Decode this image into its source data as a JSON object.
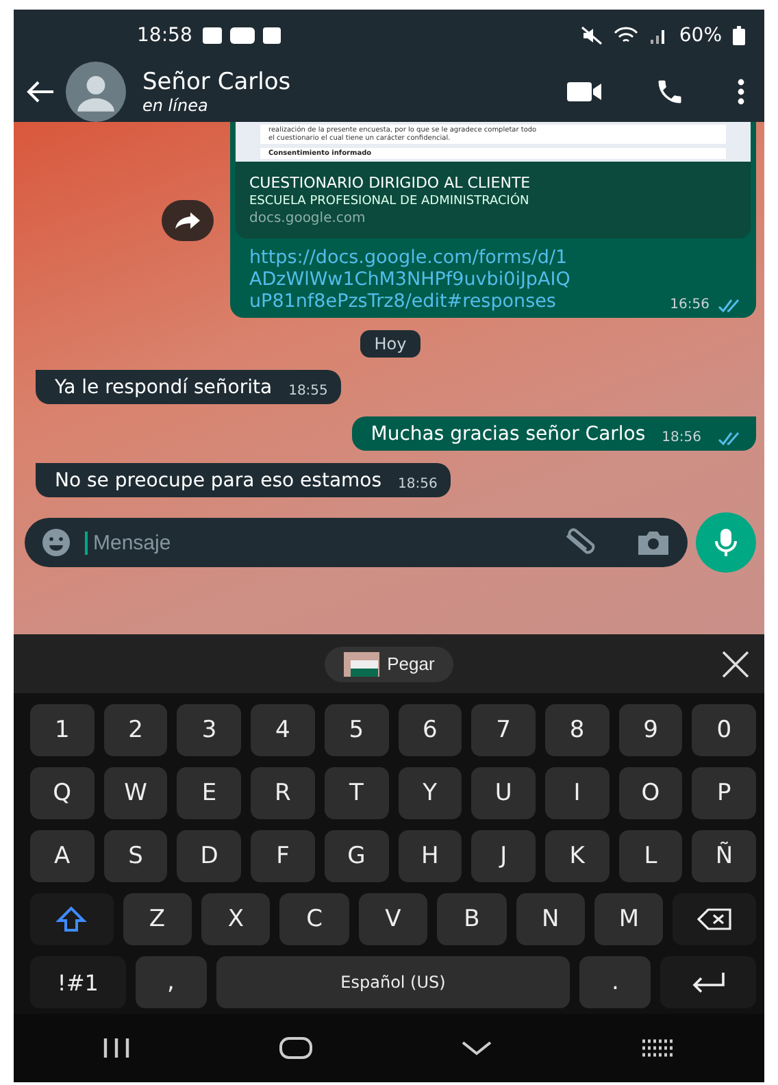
{
  "status_bar": {
    "time": "18:58",
    "battery": "60%"
  },
  "header": {
    "name": "Señor Carlos",
    "status": "en línea"
  },
  "messages": [
    {
      "kind": "link",
      "outgoing": true,
      "preview_lines": [
        "realización de la presente encuesta, por lo que se le agradece completar todo",
        "el cuestionario el cual tiene un carácter confidencial."
      ],
      "preview_heading": "Consentimiento informado",
      "title": "CUESTIONARIO DIRIGIDO AL CLIENTE",
      "subtitle": "ESCUELA PROFESIONAL DE ADMINISTRACIÓN",
      "domain": "docs.google.com",
      "text": "https://docs.google.com/forms/d/1ADzWlWw1ChM3NHPf9uvbi0iJpAIQuP81nf8ePzsTrz8/edit#responses",
      "time": "16:56",
      "read": true
    },
    {
      "kind": "date",
      "text": "Hoy"
    },
    {
      "kind": "text",
      "outgoing": false,
      "text": "Ya le respondí señorita",
      "time": "18:55"
    },
    {
      "kind": "text",
      "outgoing": true,
      "text": "Muchas gracias señor Carlos",
      "time": "18:56",
      "read": true
    },
    {
      "kind": "text",
      "outgoing": false,
      "text": "No se preocupe para eso estamos",
      "time": "18:56"
    }
  ],
  "composer": {
    "placeholder": "Mensaje"
  },
  "clipboard": {
    "label": "Pegar"
  },
  "keyboard": [
    [
      {
        "kind": "char",
        "label": "1"
      },
      {
        "kind": "char",
        "label": "2"
      },
      {
        "kind": "char",
        "label": "3"
      },
      {
        "kind": "char",
        "label": "4"
      },
      {
        "kind": "char",
        "label": "5"
      },
      {
        "kind": "char",
        "label": "6"
      },
      {
        "kind": "char",
        "label": "7"
      },
      {
        "kind": "char",
        "label": "8"
      },
      {
        "kind": "char",
        "label": "9"
      },
      {
        "kind": "char",
        "label": "0"
      }
    ],
    [
      {
        "kind": "char",
        "label": "Q"
      },
      {
        "kind": "char",
        "label": "W"
      },
      {
        "kind": "char",
        "label": "E"
      },
      {
        "kind": "char",
        "label": "R"
      },
      {
        "kind": "char",
        "label": "T"
      },
      {
        "kind": "char",
        "label": "Y"
      },
      {
        "kind": "char",
        "label": "U"
      },
      {
        "kind": "char",
        "label": "I"
      },
      {
        "kind": "char",
        "label": "O"
      },
      {
        "kind": "char",
        "label": "P"
      }
    ],
    [
      {
        "kind": "char",
        "label": "A"
      },
      {
        "kind": "char",
        "label": "S"
      },
      {
        "kind": "char",
        "label": "D"
      },
      {
        "kind": "char",
        "label": "F"
      },
      {
        "kind": "char",
        "label": "G"
      },
      {
        "kind": "char",
        "label": "H"
      },
      {
        "kind": "char",
        "label": "J"
      },
      {
        "kind": "char",
        "label": "K"
      },
      {
        "kind": "char",
        "label": "L"
      },
      {
        "kind": "char",
        "label": "Ñ"
      }
    ],
    [
      {
        "kind": "shift"
      },
      {
        "kind": "char",
        "label": "Z"
      },
      {
        "kind": "char",
        "label": "X"
      },
      {
        "kind": "char",
        "label": "C"
      },
      {
        "kind": "char",
        "label": "V"
      },
      {
        "kind": "char",
        "label": "B"
      },
      {
        "kind": "char",
        "label": "N"
      },
      {
        "kind": "char",
        "label": "M"
      },
      {
        "kind": "backspace"
      }
    ],
    [
      {
        "kind": "symbols",
        "label": "!#1"
      },
      {
        "kind": "char",
        "label": ","
      },
      {
        "kind": "space",
        "label": "Español (US)"
      },
      {
        "kind": "char",
        "label": "."
      },
      {
        "kind": "enter"
      }
    ]
  ]
}
